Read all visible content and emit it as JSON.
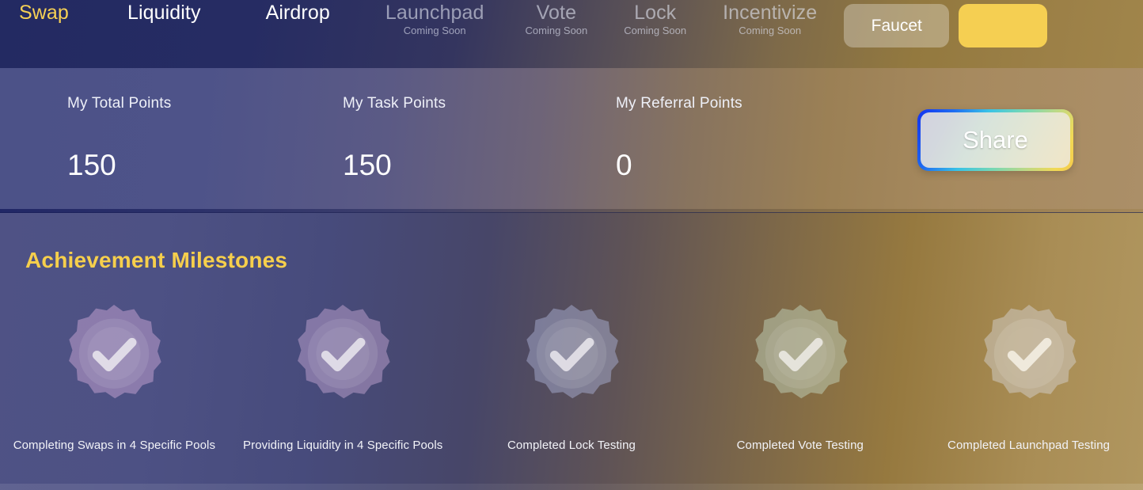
{
  "navbar": {
    "items": [
      {
        "label": "Swap",
        "sub": "",
        "state": "active"
      },
      {
        "label": "Liquidity",
        "sub": "",
        "state": "normal"
      },
      {
        "label": "Airdrop",
        "sub": "",
        "state": "normal"
      },
      {
        "label": "Launchpad",
        "sub": "Coming Soon",
        "state": "disabled"
      },
      {
        "label": "Vote",
        "sub": "Coming Soon",
        "state": "disabled"
      },
      {
        "label": "Lock",
        "sub": "Coming Soon",
        "state": "disabled"
      },
      {
        "label": "Incentivize",
        "sub": "Coming Soon",
        "state": "disabled"
      }
    ],
    "faucet_label": "Faucet",
    "wallet_label": "",
    "active_color": "#f7d154",
    "wallet_color": "#f5cf52"
  },
  "stats": {
    "total": {
      "label": "My Total Points",
      "value": "150"
    },
    "task": {
      "label": "My Task Points",
      "value": "150"
    },
    "referral": {
      "label": "My Referral Points",
      "value": "0"
    },
    "share_label": "Share"
  },
  "milestones": {
    "title": "Achievement Milestones",
    "title_color": "#f6cf4c",
    "items": [
      {
        "caption": "Completing Swaps in 4 Specific Pools",
        "icon": "verified-check-badge-icon",
        "color": "#c9a6d4"
      },
      {
        "caption": "Providing Liquidity in 4 Specific Pools",
        "icon": "verified-check-badge-icon",
        "color": "#c2a3d0"
      },
      {
        "caption": "Completed Lock Testing",
        "icon": "verified-check-badge-icon",
        "color": "#a7aed2"
      },
      {
        "caption": "Completed Vote Testing",
        "icon": "verified-check-badge-icon",
        "color": "#c2d4bc"
      },
      {
        "caption": "Completed Launchpad Testing",
        "icon": "verified-check-badge-icon",
        "color": "#cfcbc2"
      }
    ]
  }
}
